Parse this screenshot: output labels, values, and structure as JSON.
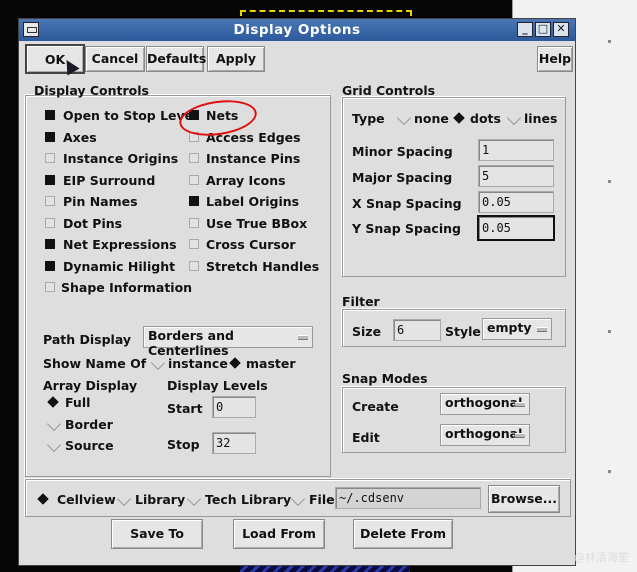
{
  "window": {
    "title": "Display Options"
  },
  "toolbar": {
    "ok": "OK",
    "cancel": "Cancel",
    "defaults": "Defaults",
    "apply": "Apply",
    "help": "Help"
  },
  "display_controls": {
    "title": "Display Controls",
    "left": [
      {
        "label": "Open to Stop Level",
        "checked": true
      },
      {
        "label": "Axes",
        "checked": true
      },
      {
        "label": "Instance Origins",
        "checked": false
      },
      {
        "label": "EIP Surround",
        "checked": true
      },
      {
        "label": "Pin Names",
        "checked": false
      },
      {
        "label": "Dot Pins",
        "checked": false
      },
      {
        "label": "Net Expressions",
        "checked": true
      },
      {
        "label": "Dynamic Hilight",
        "checked": true
      },
      {
        "label": "Shape Information",
        "checked": false
      }
    ],
    "right": [
      {
        "label": "Nets",
        "checked": true
      },
      {
        "label": "Access Edges",
        "checked": false
      },
      {
        "label": "Instance Pins",
        "checked": false
      },
      {
        "label": "Array Icons",
        "checked": false
      },
      {
        "label": "Label Origins",
        "checked": true
      },
      {
        "label": "Use True BBox",
        "checked": false
      },
      {
        "label": "Cross Cursor",
        "checked": false
      },
      {
        "label": "Stretch Handles",
        "checked": false
      }
    ],
    "path_display_label": "Path Display",
    "path_display_value": "Borders and Centerlines",
    "show_name_of_label": "Show Name Of",
    "show_name_options": [
      {
        "label": "instance",
        "selected": false
      },
      {
        "label": "master",
        "selected": true
      }
    ],
    "array_display_label": "Array Display",
    "array_options": [
      {
        "label": "Full",
        "selected": true
      },
      {
        "label": "Border",
        "selected": false
      },
      {
        "label": "Source",
        "selected": false
      }
    ],
    "display_levels_label": "Display Levels",
    "start_label": "Start",
    "start_value": "0",
    "stop_label": "Stop",
    "stop_value": "32"
  },
  "grid_controls": {
    "title": "Grid Controls",
    "type_label": "Type",
    "type_options": [
      {
        "label": "none",
        "selected": false
      },
      {
        "label": "dots",
        "selected": true
      },
      {
        "label": "lines",
        "selected": false
      }
    ],
    "minor_label": "Minor Spacing",
    "minor_value": "1",
    "major_label": "Major Spacing",
    "major_value": "5",
    "xsnap_label": "X Snap Spacing",
    "xsnap_value": "0.05",
    "ysnap_label": "Y Snap Spacing",
    "ysnap_value": "0.05"
  },
  "filter": {
    "title": "Filter",
    "size_label": "Size",
    "size_value": "6",
    "style_label": "Style",
    "style_value": "empty"
  },
  "snap_modes": {
    "title": "Snap Modes",
    "create_label": "Create",
    "create_value": "orthogonal",
    "edit_label": "Edit",
    "edit_value": "orthogonal"
  },
  "source": {
    "options": [
      {
        "label": "Cellview",
        "selected": true
      },
      {
        "label": "Library",
        "selected": false
      },
      {
        "label": "Tech Library",
        "selected": false
      },
      {
        "label": "File",
        "selected": false
      }
    ],
    "file_value": "~/.cdsenv",
    "browse": "Browse..."
  },
  "footer": {
    "save_to": "Save To",
    "load_from": "Load From",
    "delete_from": "Delete From"
  },
  "watermark": "CSDN @林清海笙",
  "colors": {
    "titlebar": "#2c5a9c",
    "annotation": "#e01010",
    "panel": "#dedede"
  }
}
